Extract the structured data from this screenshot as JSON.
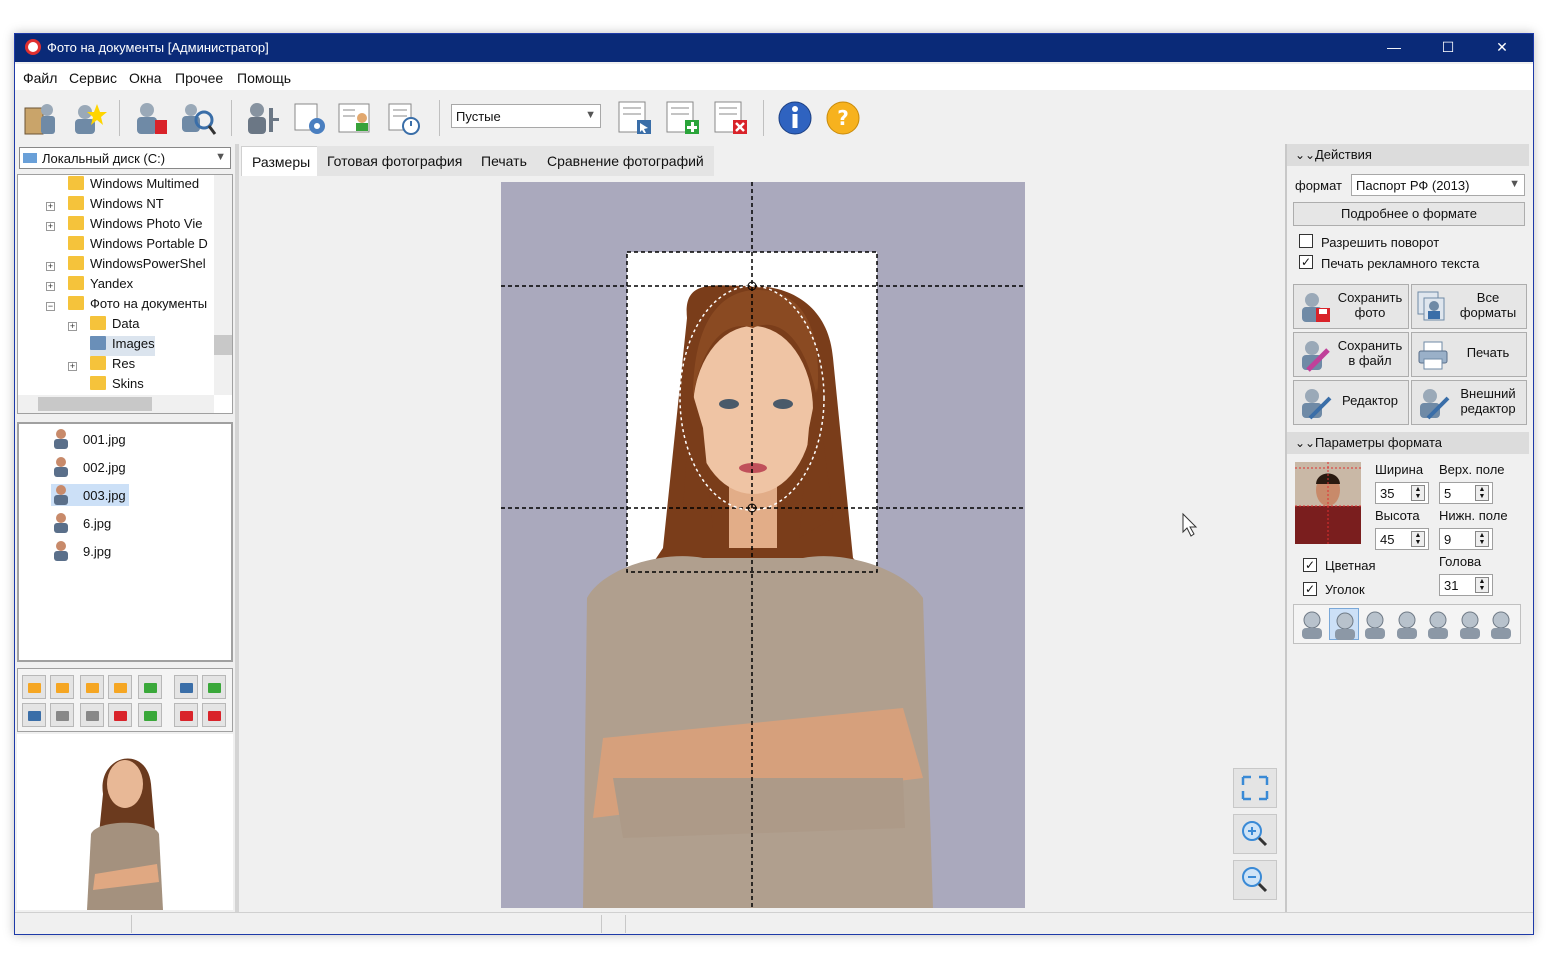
{
  "window": {
    "title": "Фото на документы  [Администратор]",
    "min": "—",
    "max": "☐",
    "close": "✕"
  },
  "menu": [
    "Файл",
    "Сервис",
    "Окна",
    "Прочее",
    "Помощь"
  ],
  "toolbar": {
    "filter_value": "Пустые",
    "icons": [
      "open-folder-icon",
      "new-photo-icon",
      "clear-photo-icon",
      "find-photo-icon",
      "keys-icon",
      "settings-icon",
      "card-icon",
      "schedule-icon",
      "select-item-icon",
      "add-item-icon",
      "remove-item-icon",
      "info-icon",
      "help-icon"
    ]
  },
  "drive": "Локальный диск (C:)",
  "tree": [
    {
      "label": "Windows Multimed",
      "expandable": false
    },
    {
      "label": "Windows NT",
      "expandable": true
    },
    {
      "label": "Windows Photo Vie",
      "expandable": true
    },
    {
      "label": "Windows Portable D",
      "expandable": false
    },
    {
      "label": "WindowsPowerShel",
      "expandable": true
    },
    {
      "label": "Yandex",
      "expandable": true
    },
    {
      "label": "Фото на документы",
      "expandable": true
    },
    {
      "label": "Data",
      "expandable": true
    },
    {
      "label": "Images",
      "expandable": false
    },
    {
      "label": "Res",
      "expandable": true
    },
    {
      "label": "Skins",
      "expandable": false
    }
  ],
  "files": [
    "001.jpg",
    "002.jpg",
    "003.jpg",
    "6.jpg",
    "9.jpg"
  ],
  "selected_file": "003.jpg",
  "tabs": [
    "Размеры",
    "Готовая фотография",
    "Печать",
    "Сравнение фотографий"
  ],
  "active_tab": "Размеры",
  "actions": {
    "header": "Действия",
    "format_label": "формат",
    "format_value": "Паспорт РФ (2013)",
    "details_button": "Подробнее о формате",
    "allow_rotate": "Разрешить поворот",
    "print_ad_text": "Печать рекламного текста",
    "allow_rotate_checked": false,
    "print_ad_checked": true,
    "buttons": [
      {
        "line1": "Сохранить",
        "line2": "фото"
      },
      {
        "line1": "Все",
        "line2": "форматы"
      },
      {
        "line1": "Сохранить",
        "line2": "в файл"
      },
      {
        "line1": "Печать",
        "line2": ""
      },
      {
        "line1": "Редактор",
        "line2": ""
      },
      {
        "line1": "Внешний",
        "line2": "редактор"
      }
    ]
  },
  "params": {
    "header": "Параметры формата",
    "width_label": "Ширина",
    "width": "35",
    "top_label": "Верх. поле",
    "top": "5",
    "height_label": "Высота",
    "height": "45",
    "bottom_label": "Нижн. поле",
    "bottom": "9",
    "color_label": "Цветная",
    "color_checked": true,
    "corner_label": "Уголок",
    "corner_checked": true,
    "head_label": "Голова",
    "head": "31"
  },
  "colors": {
    "titlebar": "#0a2a78",
    "photo_bg": "#aaa9bd",
    "selection": "#cce0f7"
  }
}
